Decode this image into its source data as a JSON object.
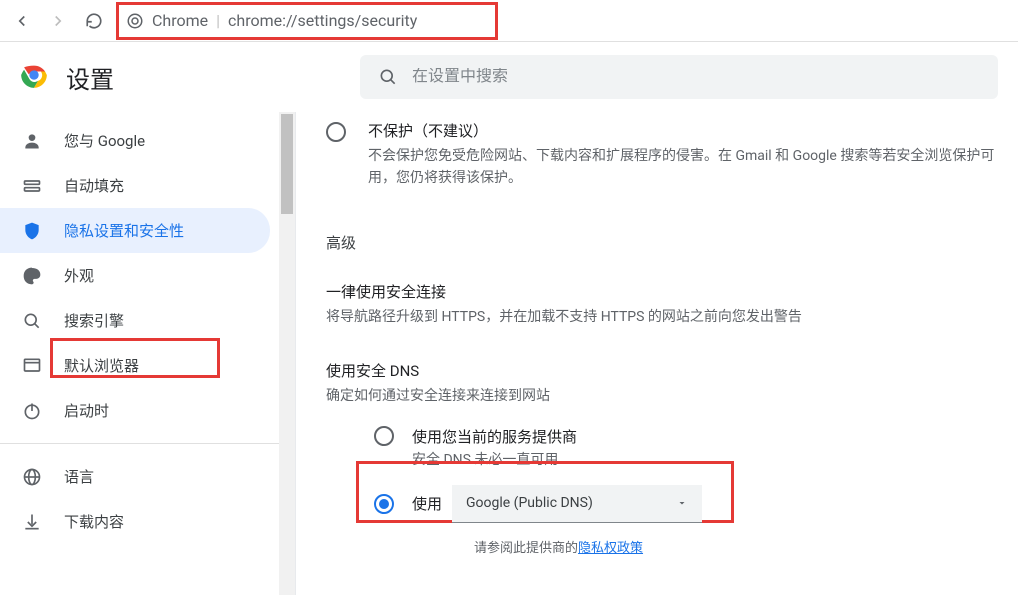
{
  "browser": {
    "url_prefix": "Chrome",
    "url_path": "chrome://settings/security"
  },
  "header": {
    "title": "设置",
    "search_placeholder": "在设置中搜索"
  },
  "sidebar": {
    "items": [
      {
        "icon": "person-icon",
        "label": "您与 Google"
      },
      {
        "icon": "autofill-icon",
        "label": "自动填充"
      },
      {
        "icon": "shield-icon",
        "label": "隐私设置和安全性",
        "active": true
      },
      {
        "icon": "palette-icon",
        "label": "外观"
      },
      {
        "icon": "search-icon",
        "label": "搜索引擎"
      },
      {
        "icon": "browser-icon",
        "label": "默认浏览器"
      },
      {
        "icon": "power-icon",
        "label": "启动时"
      }
    ],
    "items2": [
      {
        "icon": "globe-icon",
        "label": "语言"
      },
      {
        "icon": "download-icon",
        "label": "下载内容"
      }
    ]
  },
  "content": {
    "noprotect": {
      "title": "不保护（不建议）",
      "desc": "不会保护您免受危险网站、下载内容和扩展程序的侵害。在 Gmail 和 Google 搜索等若安全浏览保护可用，您仍将获得该保护。"
    },
    "advanced_label": "高级",
    "https": {
      "title": "一律使用安全连接",
      "desc": "将导航路径升级到 HTTPS，并在加载不支持 HTTPS 的网站之前向您发出警告"
    },
    "dns": {
      "title": "使用安全 DNS",
      "desc": "确定如何通过安全连接来连接到网站",
      "opt1_title": "使用您当前的服务提供商",
      "opt1_desc": "安全 DNS 未必一直可用",
      "opt2_label": "使用",
      "select_value": "Google (Public DNS)",
      "note_prefix": "请参阅此提供商的",
      "note_link": "隐私权政策"
    }
  }
}
